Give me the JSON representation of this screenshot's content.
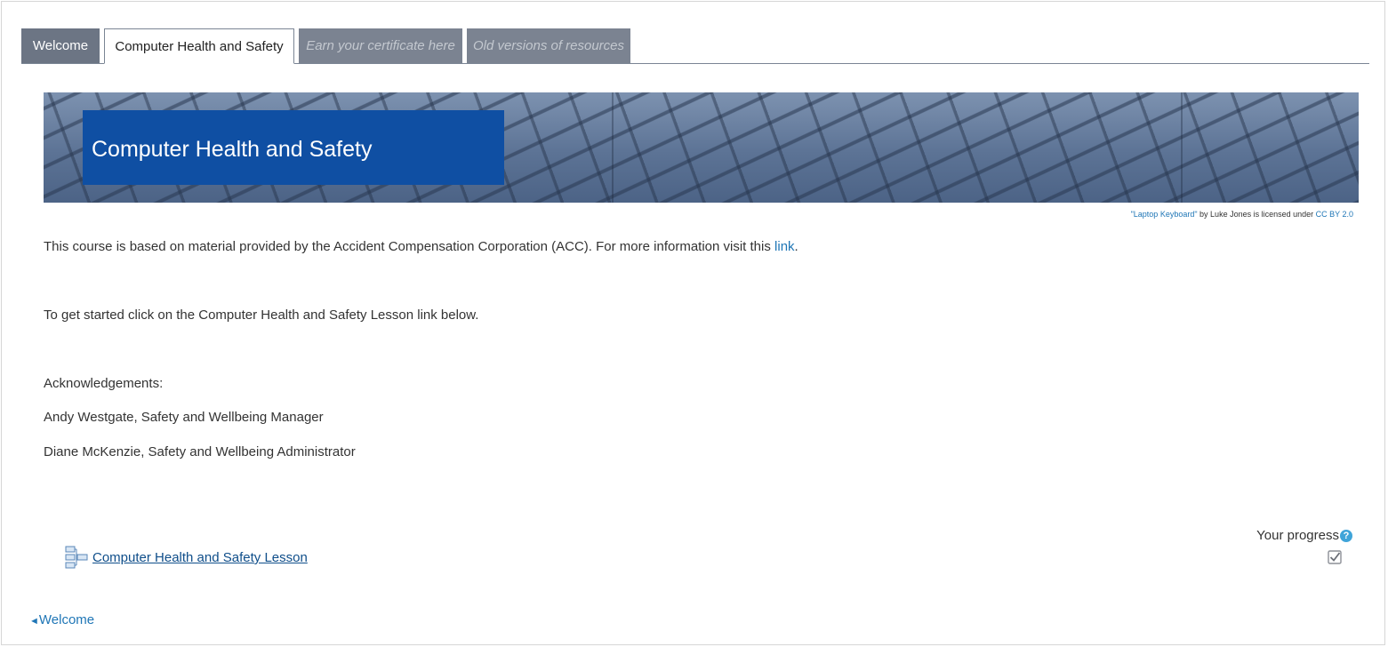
{
  "tabs": {
    "welcome": "Welcome",
    "active": "Computer Health and Safety",
    "earn": "Earn your certificate here",
    "old": "Old versions of resources"
  },
  "banner": {
    "title": "Computer Health and Safety"
  },
  "attribution": {
    "work_link": "\"Laptop Keyboard\"",
    "middle": " by Luke Jones is licensed under ",
    "license_link": "CC BY 2.0"
  },
  "content": {
    "intro_text": "This course is based on material provided by the Accident Compensation Corporation (ACC). For more information visit this ",
    "intro_link": "link",
    "intro_end": ".",
    "get_started": "To get started click on the Computer Health and Safety Lesson link below.",
    "acknowledgements": "Acknowledgements:",
    "ack1": "Andy Westgate, Safety and Wellbeing Manager",
    "ack2": "Diane McKenzie, Safety and Wellbeing Administrator"
  },
  "progress": {
    "label": "Your progress",
    "help_icon": "?"
  },
  "activity": {
    "label": "Computer Health and Safety Lesson",
    "icon": "lesson-icon"
  },
  "nav": {
    "prev_arrow": "◄",
    "prev_label": "Welcome"
  },
  "colors": {
    "tab_inactive": "#6c7584",
    "banner_box": "#0f4fa3",
    "link": "#1f76b6"
  }
}
